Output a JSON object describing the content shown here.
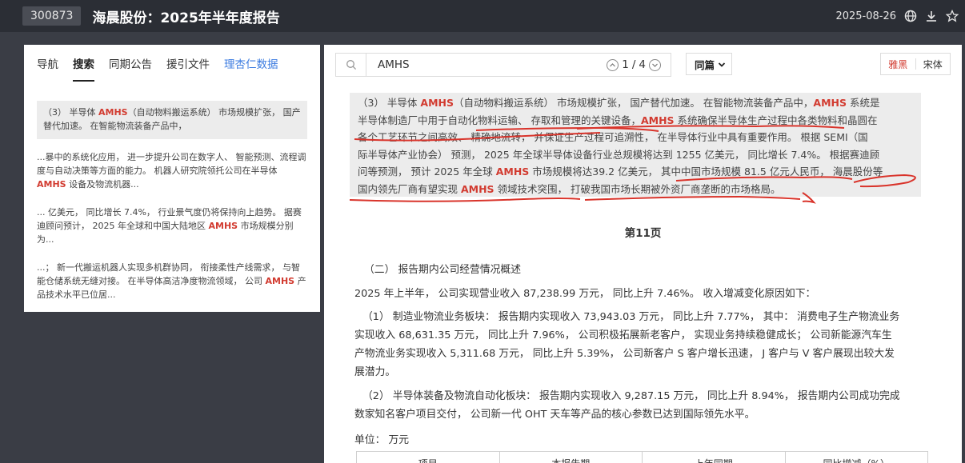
{
  "header": {
    "code": "300873",
    "title": "海晨股份：2025年半年度报告",
    "date": "2025-08-26"
  },
  "left_panel": {
    "tabs": [
      {
        "label": "导航"
      },
      {
        "label": "搜索"
      },
      {
        "label": "同期公告"
      },
      {
        "label": "援引文件"
      },
      {
        "label": "理杏仁数据"
      }
    ],
    "active_tab": "搜索",
    "results": [
      {
        "pre": "（3） 半导体 ",
        "hl": "AMHS",
        "post": "（自动物料搬运系统） 市场规模扩张， 国产替代加速。 在智能物流装备产品中，"
      },
      {
        "pre": "...暴中的系统化应用， 进一步提升公司在数字人、 智能预测、流程调度与自动决策等方面的能力。 机器人研究院领托公司在半导体 ",
        "hl": "AMHS",
        "post": " 设备及物流机器..."
      },
      {
        "pre": "... 亿美元， 同比增长 7.4%， 行业景气度仍将保持向上趋势。 据赛迪顾问预计， 2025 年全球和中国大陆地区 ",
        "hl": "AMHS",
        "post": " 市场规模分别为..."
      },
      {
        "pre": "...； 新一代搬运机器人实现多机群协同， 衔接柔性产线需求， 与智能仓储系统无缝对接。 在半导体高洁净度物流领域， 公司 ",
        "hl": "AMHS",
        "post": " 产品技术水平已位居..."
      }
    ]
  },
  "search": {
    "query": "AMHS",
    "current": "1",
    "total": "4",
    "scope": "同篇",
    "fonts": [
      "雅黑",
      "宋体"
    ],
    "active_font": "雅黑"
  },
  "document": {
    "highlight_lines": [
      [
        {
          "t": "（3） 半导体 "
        },
        {
          "t": "AMHS",
          "h": 1
        },
        {
          "t": "（自动物料搬运系统） 市场规模扩张， 国产替代加速。 在智能物流装备产品中，"
        },
        {
          "t": "AMHS",
          "h": 1
        },
        {
          "t": " 系统是"
        }
      ],
      [
        {
          "t": "半导体制造厂中用于自动化物料运输、 存取和管理的关键设备，"
        },
        {
          "t": "AMHS",
          "h": 1
        },
        {
          "t": " 系统确保半导体生产过程中各类物料和晶圆在"
        }
      ],
      [
        {
          "t": "各个工艺环节之间高效、 精确地流转， 并保证生产过程可追溯性， 在半导体行业中具有重要作用。 根据 SEMI（国"
        }
      ],
      [
        {
          "t": "际半导体产业协会） 预测， 2025 年全球半导体设备行业总规模将达到 1255 亿美元， 同比增长 7.4%。 根据赛迪顾"
        }
      ],
      [
        {
          "t": "问等预测， 预计 2025 年全球 "
        },
        {
          "t": "AMHS",
          "h": 1
        },
        {
          "t": " 市场规模将达39.2 亿美元， 其中中国市场规模 81.5 亿元人民币， 海晨股份等"
        }
      ],
      [
        {
          "t": "国内领先厂商有望实现 "
        },
        {
          "t": "AMHS",
          "h": 1
        },
        {
          "t": " 领域技术突围， 打破我国市场长期被外资厂商垄断的市场格局。"
        }
      ]
    ],
    "page_label": "第11页",
    "section_title": "（二） 报告期内公司经营情况概述",
    "p1": "2025 年上半年， 公司实现营业收入 87,238.99 万元， 同比上升 7.46%。 收入增减变化原因如下：",
    "p2_l1": "（1） 制造业物流业务板块： 报告期内实现收入 73,943.03 万元， 同比上升 7.77%， 其中： 消费电子生产物流业务",
    "p2_l2": "实现收入 68,631.35 万元， 同比上升 7.96%， 公司积极拓展新老客户， 实现业务持续稳健成长； 公司新能源汽车生",
    "p2_l3": "产物流业务实现收入 5,311.68 万元， 同比上升 5.39%， 公司新客户 S 客户增长迅速， J 客户与 V 客户展现出较大发",
    "p2_l4": "展潜力。",
    "p3_l1": "（2） 半导体装备及物流自动化板块： 报告期内实现收入 9,287.15 万元， 同比上升 8.94%， 报告期内公司成功完成",
    "p3_l2": "数家知名客户项目交付， 公司新一代 OHT 天车等产品的核心参数已达到国际领先水平。",
    "unit": "单位： 万元",
    "table_headers": [
      "项目",
      "本报告期",
      "上年同期",
      "同比增减（%）"
    ]
  },
  "colors": {
    "highlight": "#d23b30",
    "pen": "#d9342b",
    "link": "#3b7be0"
  }
}
